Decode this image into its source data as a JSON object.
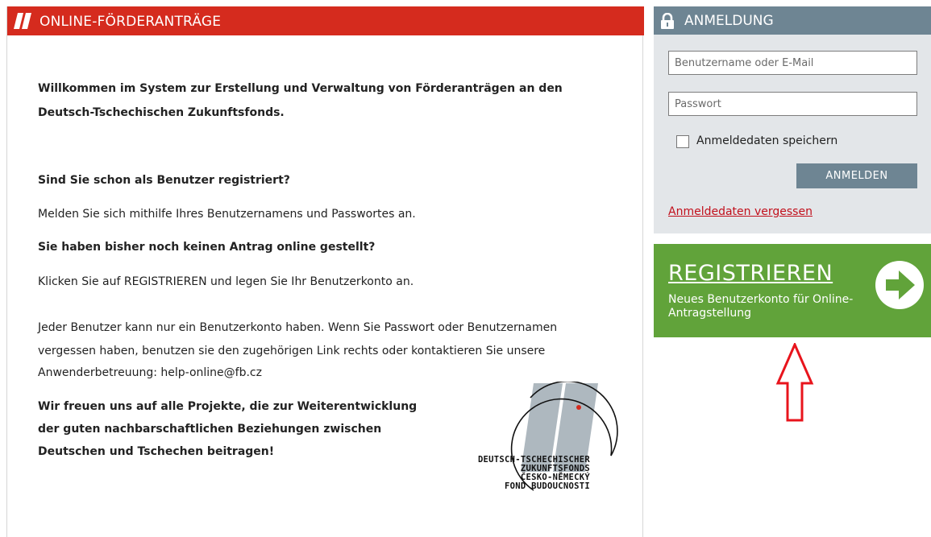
{
  "main": {
    "title": "ONLINE-FÖRDERANTRÄGE",
    "welcome_line1": "Willkommen im System zur Erstellung und Verwaltung von Förderanträgen an den",
    "welcome_line2": "Deutsch-Tschechischen Zukunftsfonds.",
    "registered_question": "Sind Sie schon als Benutzer registriert?",
    "registered_answer": "Melden Sie sich mithilfe Ihres Benutzernamens und Passwortes an.",
    "new_question": "Sie haben bisher noch keinen Antrag online gestellt?",
    "new_answer": "Klicken Sie auf REGISTRIEREN und legen Sie Ihr Benutzerkonto an.",
    "info_line1": "Jeder Benutzer kann nur ein Benutzerkonto haben. Wenn Sie Passwort oder Benutzernamen",
    "info_line2": "vergessen haben, benutzen sie den zugehörigen Link rechts oder kontaktieren Sie unsere",
    "info_line3": "Anwenderbetreuung: help-online@fb.cz",
    "closing_line1": "Wir freuen uns auf alle Projekte, die zur Weiterentwicklung",
    "closing_line2": "der guten nachbarschaftlichen Beziehungen zwischen",
    "closing_line3": "Deutschen und Tschechen beitragen!",
    "seal": [
      "DEUTSCH-TSCHECHISCHER",
      "ZUKUNFTSFONDS",
      "ČESKO-NĚMECKÝ",
      "FOND BUDOUCNOSTI"
    ]
  },
  "login": {
    "title": "ANMELDUNG",
    "username_placeholder": "Benutzername oder E-Mail",
    "username_value": "",
    "password_placeholder": "Passwort",
    "password_value": "",
    "remember_label": "Anmeldedaten speichern",
    "remember_checked": false,
    "submit_label": "ANMELDEN",
    "forgot_link": "Anmeldedaten vergessen"
  },
  "register": {
    "title": "REGISTRIEREN",
    "description": "Neues Benutzerkonto für Online-Antragstellung"
  },
  "colors": {
    "header_red": "#d52b1e",
    "login_header": "#6e8593",
    "login_panel": "#e3e6e9",
    "register_green": "#61a33a",
    "link_red": "#c2101c"
  },
  "icons": [
    "brand-slash-icon",
    "lock-icon",
    "arrow-right-circle-icon",
    "red-up-arrow-icon"
  ]
}
